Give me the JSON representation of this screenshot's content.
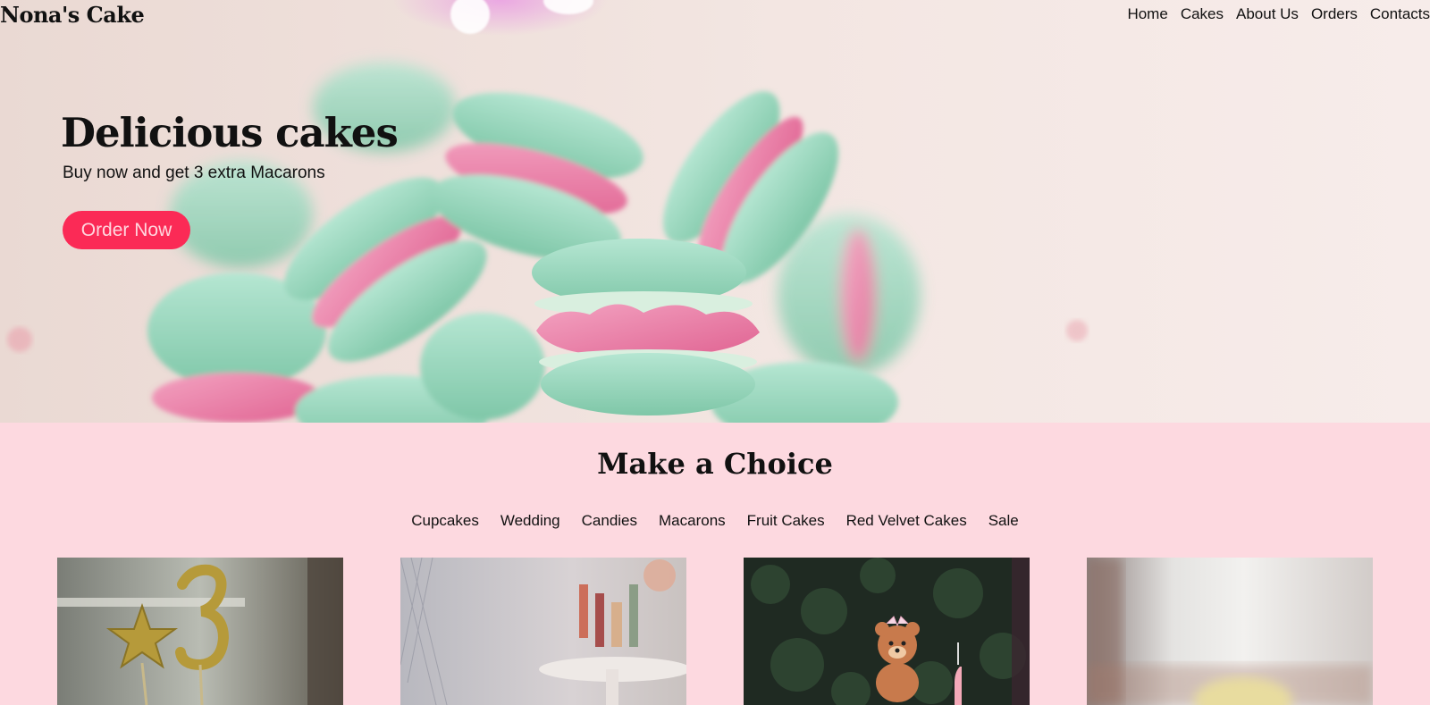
{
  "header": {
    "logo": "Nona's Cake",
    "nav": [
      "Home",
      "Cakes",
      "About Us",
      "Orders",
      "Contacts"
    ]
  },
  "hero": {
    "title": "Delicious cakes",
    "subtitle": "Buy now and get 3 extra Macarons",
    "cta_label": "Order Now"
  },
  "choice": {
    "title": "Make a Choice",
    "categories": [
      "Cupcakes",
      "Wedding",
      "Candies",
      "Macarons",
      "Fruit Cakes",
      "Red Velvet Cakes",
      "Sale"
    ]
  },
  "colors": {
    "accent": "#fb2a56",
    "section_bg": "#fdd9e0",
    "macaron_green": "#9fd9c0",
    "macaron_pink": "#ec7fa6"
  }
}
